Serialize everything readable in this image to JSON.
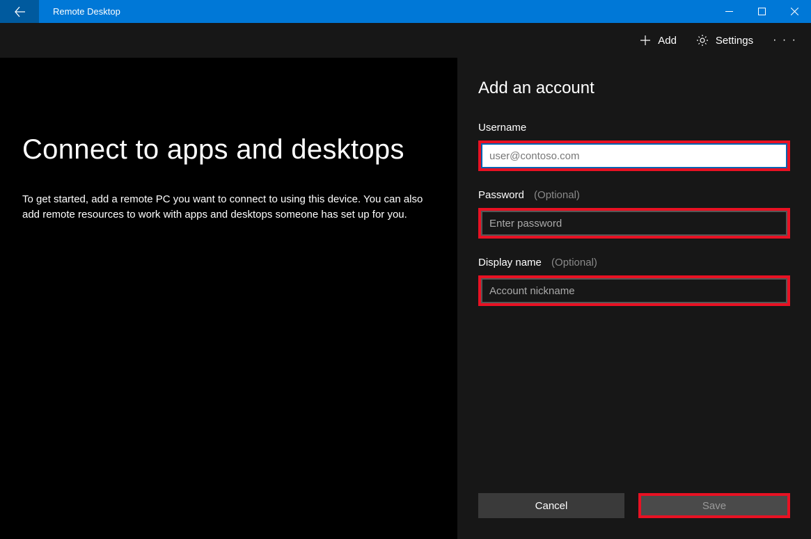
{
  "titlebar": {
    "title": "Remote Desktop"
  },
  "toolbar": {
    "add_label": "Add",
    "settings_label": "Settings"
  },
  "main": {
    "heading": "Connect to apps and desktops",
    "description": "To get started, add a remote PC you want to connect to using this device. You can also add remote resources to work with apps and desktops someone has set up for you."
  },
  "panel": {
    "title": "Add an account",
    "username_label": "Username",
    "username_placeholder": "user@contoso.com",
    "username_value": "",
    "password_label": "Password",
    "password_hint": "(Optional)",
    "password_placeholder": "Enter password",
    "password_value": "",
    "displayname_label": "Display name",
    "displayname_hint": "(Optional)",
    "displayname_placeholder": "Account nickname",
    "displayname_value": "",
    "cancel_label": "Cancel",
    "save_label": "Save"
  }
}
